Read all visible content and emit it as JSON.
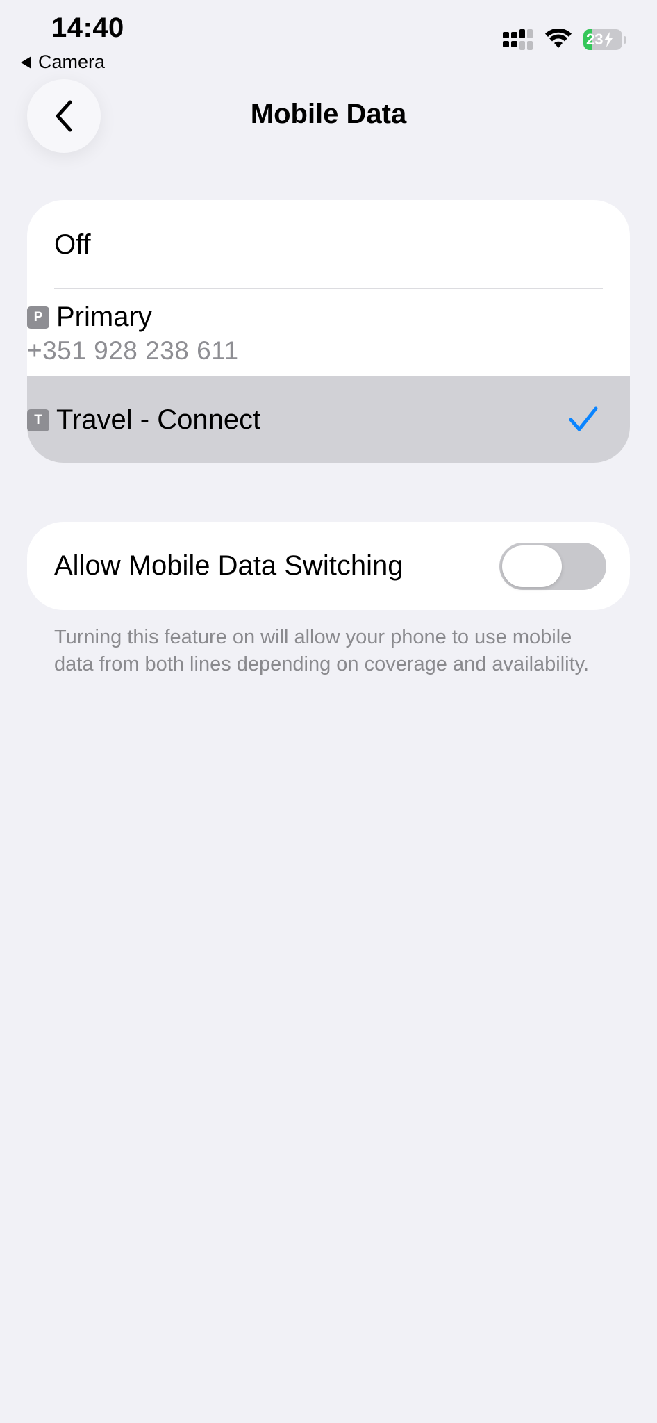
{
  "status_bar": {
    "time": "14:40",
    "back_app": "Camera",
    "battery_level": "23",
    "battery_fraction": 0.23,
    "icons": [
      "cellular-dual-sim-icon",
      "wifi-icon",
      "battery-charging-icon"
    ]
  },
  "nav": {
    "title": "Mobile Data",
    "back_icon": "chevron-left-icon"
  },
  "lines": {
    "off_label": "Off",
    "primary": {
      "badge": "P",
      "name": "Primary",
      "number": "+351 928 238 611"
    },
    "travel": {
      "badge": "T",
      "name": "Travel - Connect",
      "selected": true
    }
  },
  "switching": {
    "label": "Allow Mobile Data Switching",
    "enabled": false,
    "footer": "Turning this feature on will allow your phone to use mobile data from both lines depending on coverage and availability."
  },
  "colors": {
    "background": "#f1f1f6",
    "accent": "#0a84ff",
    "selected_row": "#d1d1d6",
    "toggle_off": "#c8c8cc",
    "secondary_text": "#8e8e93"
  }
}
